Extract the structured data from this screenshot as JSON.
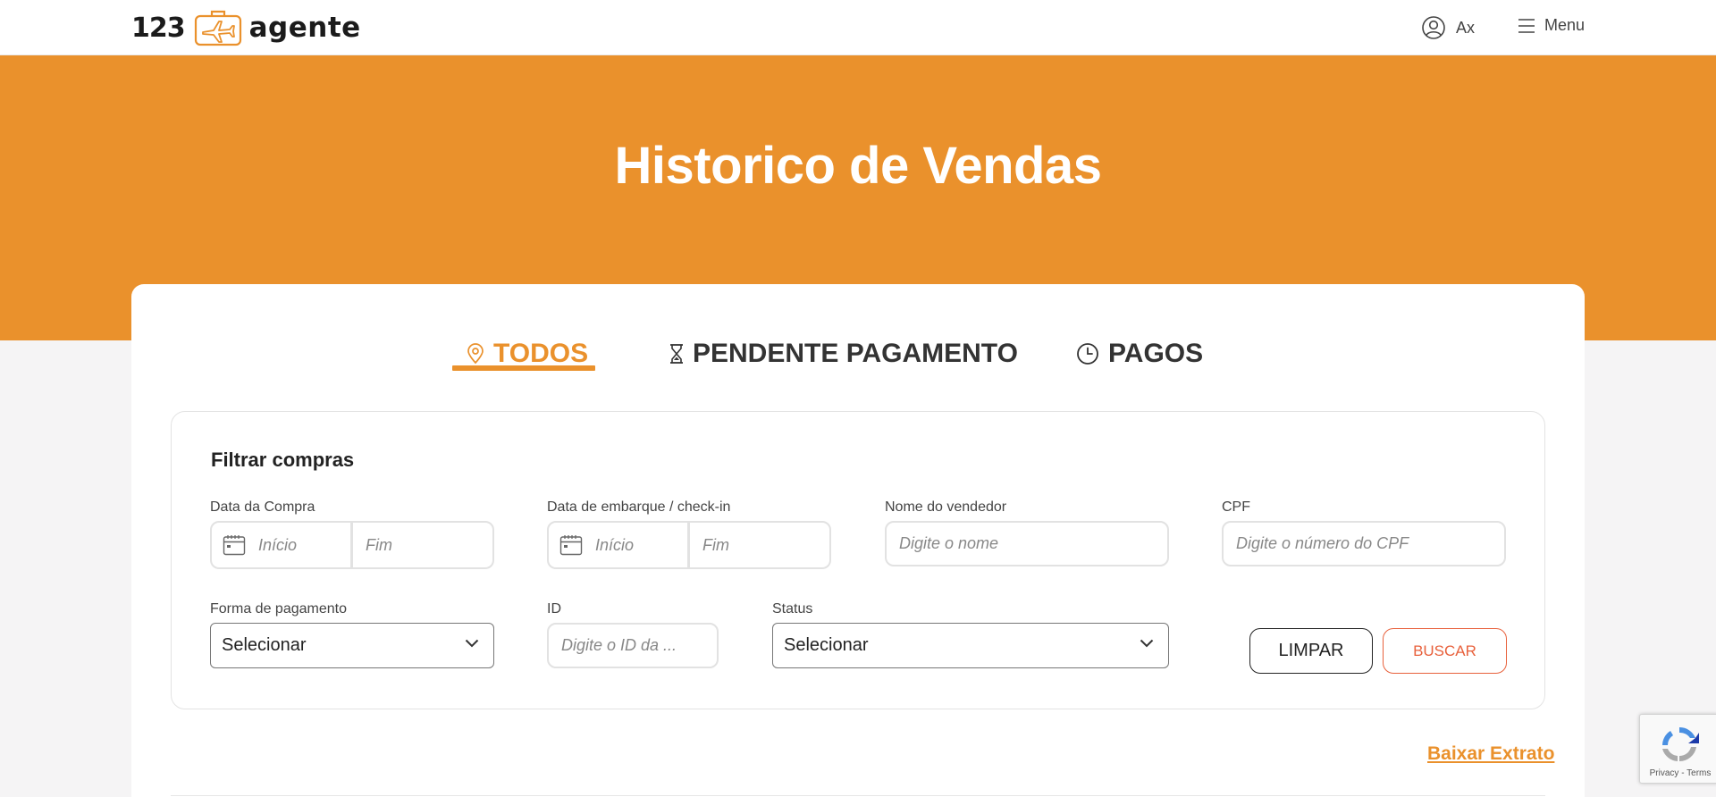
{
  "brand": {
    "logo_number": "123",
    "logo_word": "agente",
    "accent_color": "#ea912c"
  },
  "header": {
    "user_name": "Ax",
    "menu_label": "Menu",
    "icons": {
      "user": "user-circle-icon",
      "menu": "hamburger-icon"
    }
  },
  "hero": {
    "title": "Historico de Vendas"
  },
  "tabs": [
    {
      "label": "TODOS",
      "icon": "location-pin-icon",
      "active": true
    },
    {
      "label": "PENDENTE PAGAMENTO",
      "icon": "hourglass-icon",
      "active": false
    },
    {
      "label": "PAGOS",
      "icon": "clock-icon",
      "active": false
    }
  ],
  "filters": {
    "title": "Filtrar compras",
    "purchase_date": {
      "label": "Data da Compra",
      "start_placeholder": "Início",
      "end_placeholder": "Fim"
    },
    "boarding_date": {
      "label": "Data de embarque / check-in",
      "start_placeholder": "Início",
      "end_placeholder": "Fim"
    },
    "seller_name": {
      "label": "Nome do vendedor",
      "placeholder": "Digite o nome"
    },
    "cpf": {
      "label": "CPF",
      "placeholder": "Digite o número do CPF"
    },
    "payment_method": {
      "label": "Forma de pagamento",
      "value": "Selecionar"
    },
    "id": {
      "label": "ID",
      "placeholder": "Digite o ID da ..."
    },
    "status": {
      "label": "Status",
      "value": "Selecionar"
    },
    "clear_label": "LIMPAR",
    "search_label": "BUSCAR"
  },
  "download_label": "Baixar Extrato",
  "recaptcha": {
    "footer": "Privacy - Terms"
  }
}
